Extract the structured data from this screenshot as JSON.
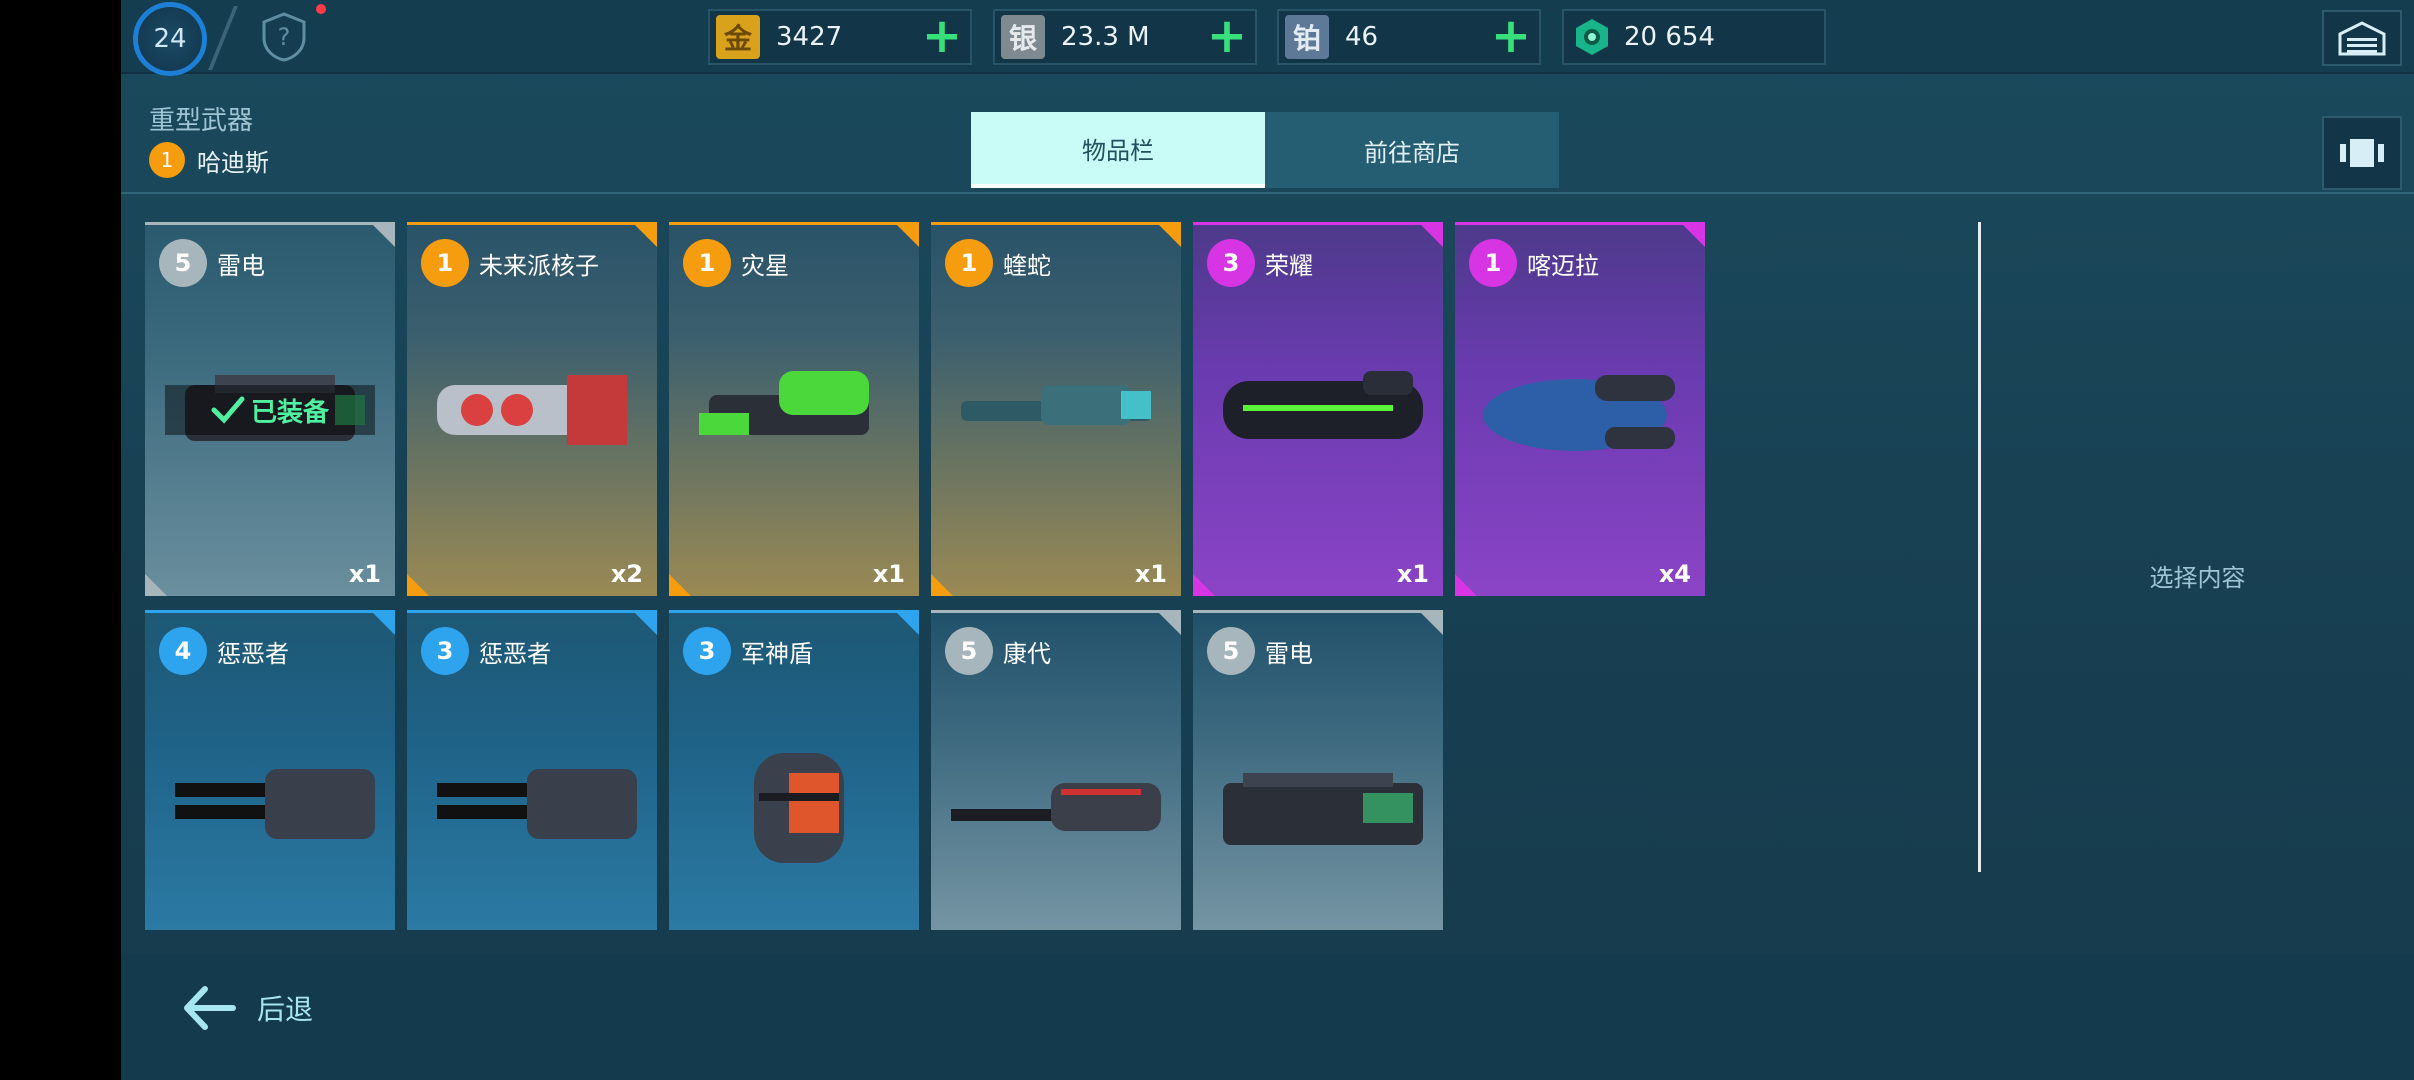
{
  "topbar": {
    "level": "24",
    "currencies": [
      {
        "glyph": "金",
        "value": "3427",
        "color": "#d9a21c"
      },
      {
        "glyph": "银",
        "value": "23.3 M",
        "color": "#8d979d"
      },
      {
        "glyph": "铂",
        "value": "46",
        "color": "#6d87a8"
      },
      {
        "glyph": "",
        "value": "20 654",
        "color": "#19b58a"
      }
    ],
    "plus": "+"
  },
  "header": {
    "category": "重型武器",
    "weapon_tier": "1",
    "weapon_name": "哈迪斯"
  },
  "tabs": {
    "inventory": "物品栏",
    "shop": "前往商店"
  },
  "cards": [
    {
      "tier": "5",
      "name": "雷电",
      "count": "x1",
      "rarity": "grey",
      "equipped": true
    },
    {
      "tier": "1",
      "name": "未来派核子",
      "count": "x2",
      "rarity": "orange"
    },
    {
      "tier": "1",
      "name": "灾星",
      "count": "x1",
      "rarity": "orange"
    },
    {
      "tier": "1",
      "name": "蝰蛇",
      "count": "x1",
      "rarity": "orange"
    },
    {
      "tier": "3",
      "name": "荣耀",
      "count": "x1",
      "rarity": "purple"
    },
    {
      "tier": "1",
      "name": "喀迈拉",
      "count": "x4",
      "rarity": "purple"
    },
    {
      "tier": "4",
      "name": "惩恶者",
      "count": "",
      "rarity": "blue"
    },
    {
      "tier": "3",
      "name": "惩恶者",
      "count": "",
      "rarity": "blue"
    },
    {
      "tier": "3",
      "name": "军神盾",
      "count": "",
      "rarity": "blue"
    },
    {
      "tier": "5",
      "name": "康代",
      "count": "",
      "rarity": "greyblue"
    },
    {
      "tier": "5",
      "name": "雷电",
      "count": "",
      "rarity": "greyblue"
    }
  ],
  "equipped_label": "已装备",
  "side_panel": {
    "placeholder": "选择内容"
  },
  "footer": {
    "back_label": "后退"
  },
  "colors": {
    "orange": "#f59c0f",
    "purple": "#d735e3",
    "blue": "#2ea4ee",
    "grey": "#a7b6bd",
    "accent_green": "#37e07b"
  }
}
